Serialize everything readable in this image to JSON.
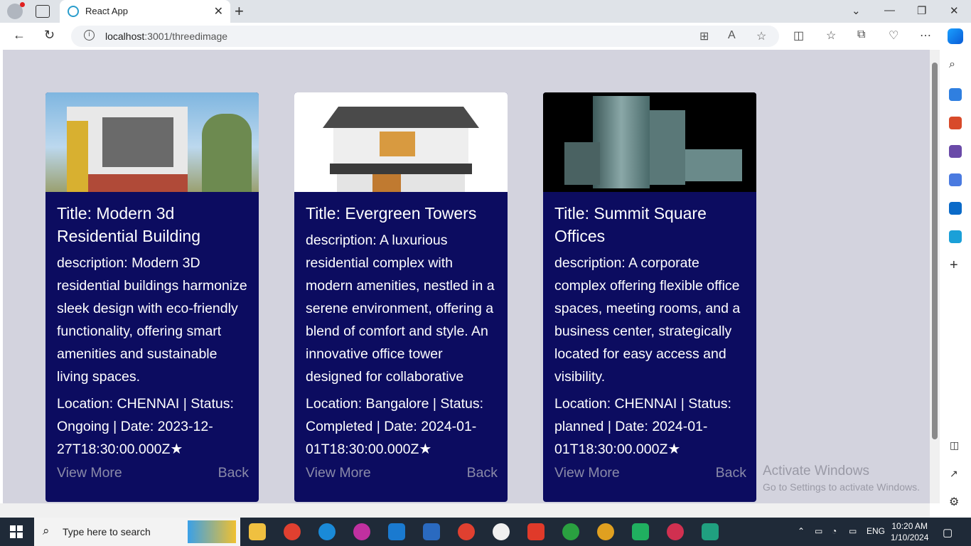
{
  "browser": {
    "tab_title": "React App",
    "url_host": "localhost",
    "url_rest": ":3001/threedimage"
  },
  "cards": [
    {
      "title": "Title: Modern 3d Residential Building",
      "description": "description: Modern 3D residential buildings harmonize sleek design with eco-friendly functionality, offering smart amenities and sustainable living spaces.",
      "meta": "Location: CHENNAI | Status: Ongoing | Date: 2023-12-27T18:30:00.000Z",
      "view_more": "View More",
      "back": "Back"
    },
    {
      "title": "Title: Evergreen Towers",
      "description": "description: A luxurious residential complex with modern amenities, nestled in a serene environment, offering a blend of comfort and style. An innovative office tower designed for collaborative",
      "meta": "Location: Bangalore | Status: Completed | Date: 2024-01-01T18:30:00.000Z",
      "view_more": "View More",
      "back": "Back"
    },
    {
      "title": "Title: Summit Square Offices",
      "description": "description: A corporate complex offering flexible office spaces, meeting rooms, and a business center, strategically located for easy access and visibility.",
      "meta": "Location: CHENNAI | Status: planned | Date: 2024-01-01T18:30:00.000Z",
      "view_more": "View More",
      "back": "Back"
    }
  ],
  "watermark": {
    "line1": "Activate Windows",
    "line2": "Go to Settings to activate Windows."
  },
  "taskbar": {
    "search_placeholder": "Type here to search",
    "language": "ENG",
    "time": "10:20 AM",
    "date": "1/10/2024"
  }
}
